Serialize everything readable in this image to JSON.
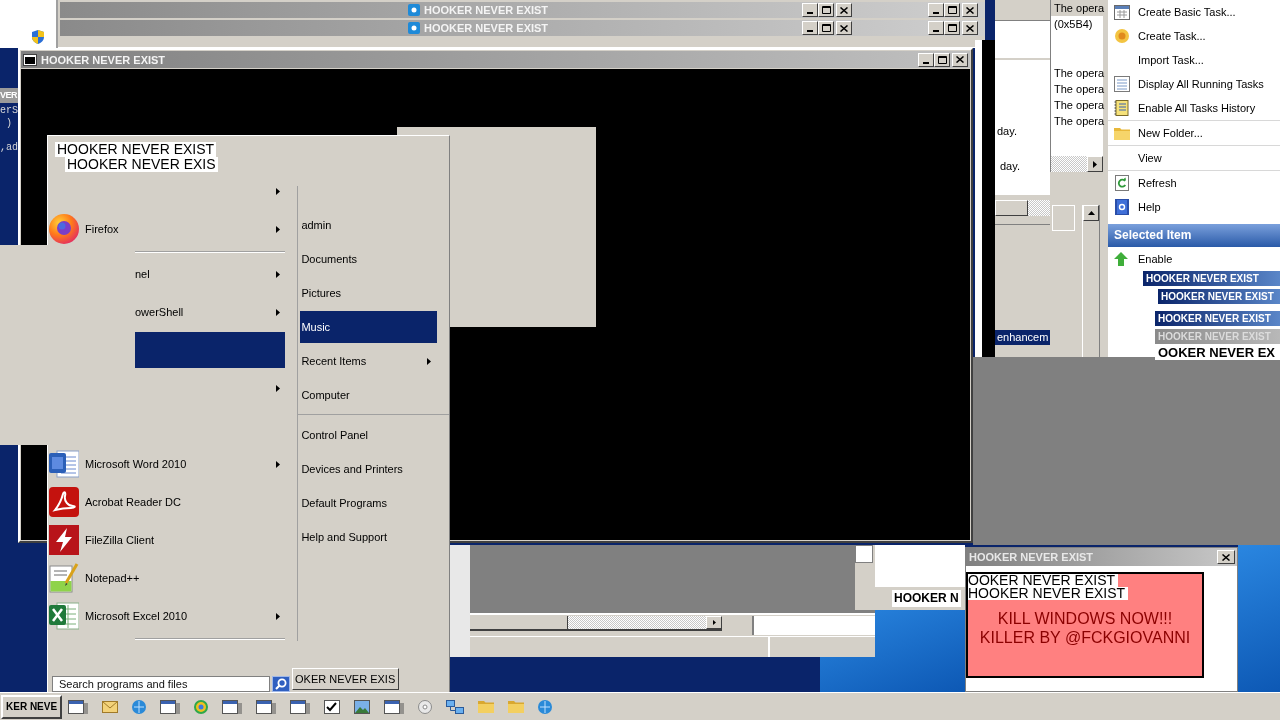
{
  "desktop": {
    "title_fragment": "VER",
    "console_fragments": [
      "erS",
      ")",
      ",ad"
    ]
  },
  "background_windows": [
    {
      "title": "HOOKER NEVER EXIST"
    },
    {
      "title": "HOOKER NEVER EXIST"
    }
  ],
  "task_scheduler": {
    "log_messages": [
      {
        "text": "The opera",
        "selected": true
      },
      {
        "text": "(0x5B4)",
        "selected": false
      },
      {
        "text": "The opera",
        "selected": false
      },
      {
        "text": "The opera",
        "selected": false
      },
      {
        "text": "The opera",
        "selected": false
      },
      {
        "text": "The opera",
        "selected": false
      }
    ],
    "history_fragments": [
      "day.",
      "day."
    ],
    "list_rows": [
      {
        "text": "enhancem",
        "selected": true
      }
    ],
    "action_groups": [
      [
        "Create Basic Task...",
        "Create Task...",
        "Import Task...",
        "Display All Running Tasks",
        "Enable All Tasks History"
      ],
      [
        "New Folder..."
      ],
      [
        "View"
      ],
      [
        "Refresh",
        "Help"
      ]
    ],
    "section_header": "Selected Item",
    "item_actions": [
      "Enable"
    ]
  },
  "stacked_title_bars": [
    {
      "title": "HOOKER NEVER EXIST",
      "kind": "active"
    },
    {
      "title": "HOOKER NEVER EXIST",
      "kind": "active"
    },
    {
      "title": "HOOKER NEVER EXIST",
      "kind": "active"
    },
    {
      "title": "HOOKER NEVER EXIST",
      "kind": "inactive"
    },
    {
      "title": "OOKER NEVER EX",
      "kind": "label"
    }
  ],
  "main_window": {
    "title": "HOOKER NEVER EXIST"
  },
  "start_menu": {
    "overlay_labels": [
      "HOOKER NEVER EXIST",
      "HOOKER NEVER EXIS"
    ],
    "program_groups": [
      [
        {
          "kind": "partial",
          "submenu": true,
          "selected": false
        },
        {
          "kind": "app",
          "label": "Firefox",
          "submenu": true,
          "selected": false
        }
      ],
      [
        {
          "kind": "partial",
          "label": "nel",
          "submenu": true,
          "selected": false
        },
        {
          "kind": "partial",
          "label": "owerShell",
          "submenu": true,
          "selected": false
        },
        {
          "kind": "partial",
          "submenu": false,
          "selected": true
        },
        {
          "kind": "partial",
          "submenu": true,
          "selected": false
        },
        {
          "kind": "partial",
          "submenu": false,
          "selected": false
        },
        {
          "kind": "app",
          "label": "Microsoft Word 2010",
          "submenu": true,
          "selected": false
        },
        {
          "kind": "app",
          "label": "Acrobat Reader DC",
          "submenu": false,
          "selected": false
        },
        {
          "kind": "app",
          "label": "FileZilla Client",
          "submenu": false,
          "selected": false
        },
        {
          "kind": "app",
          "label": "Notepad++",
          "submenu": false,
          "selected": false
        },
        {
          "kind": "app",
          "label": "Microsoft Excel 2010",
          "submenu": true,
          "selected": false
        }
      ]
    ],
    "place_groups": [
      [
        {
          "label": "admin",
          "submenu": false,
          "selected": false
        },
        {
          "label": "Documents",
          "submenu": false,
          "selected": false
        },
        {
          "label": "Pictures",
          "submenu": false,
          "selected": false
        },
        {
          "label": "Music",
          "submenu": false,
          "selected": true
        },
        {
          "label": "Recent Items",
          "submenu": true,
          "selected": false
        },
        {
          "label": "Computer",
          "submenu": false,
          "selected": false
        }
      ],
      [
        {
          "label": "Control Panel",
          "submenu": false,
          "selected": false
        },
        {
          "label": "Devices and Printers",
          "submenu": false,
          "selected": false
        },
        {
          "label": "Default Programs",
          "submenu": false,
          "selected": false
        },
        {
          "label": "Help and Support",
          "submenu": false,
          "selected": false
        }
      ]
    ],
    "search": {
      "placeholder": "Search programs and files"
    }
  },
  "floating_labels": [
    "OKER NEVER EXIS",
    "HOOKER N"
  ],
  "dialog": {
    "title": "HOOKER NEVER EXIST",
    "labels": [
      "OOKER NEVER EXIST",
      "HOOKER NEVER EXIST"
    ],
    "message": [
      "KILL WINDOWS NOW!!!",
      "KILLER BY @FCKGIOVANNI"
    ]
  },
  "taskbar": {
    "button_label": "KER NEVE"
  }
}
